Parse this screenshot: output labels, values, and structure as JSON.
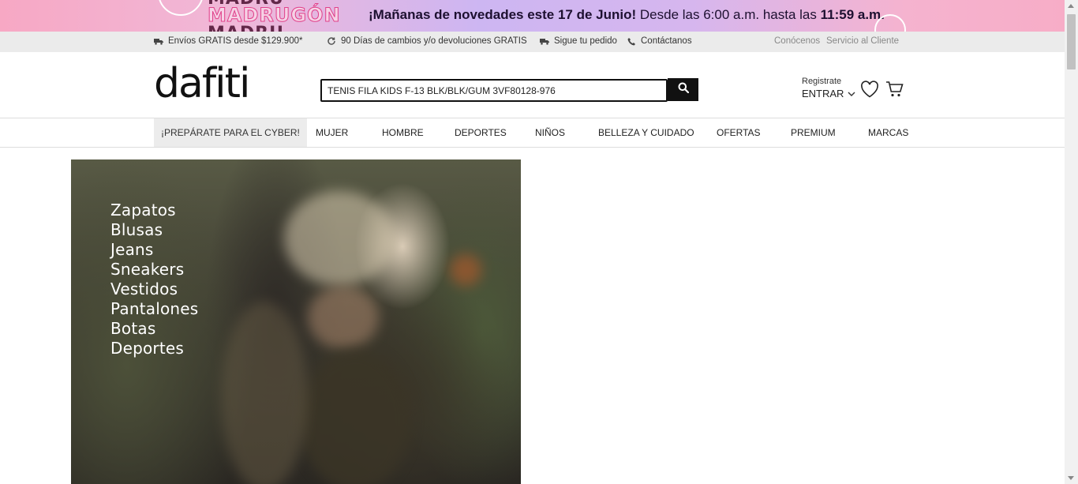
{
  "promo_banner": {
    "brand": "MADRUGÓN",
    "message_bold": "¡Mañanas de novedades este 17 de Junio!",
    "message_regular": "Desde las 6:00 a.m. hasta las",
    "message_time": "11:59 a.m."
  },
  "utility_bar": {
    "shipping": "Envíos GRATIS desde $129.900*",
    "returns": "90 Días de cambios y/o devoluciones GRATIS",
    "track": "Sigue tu pedido",
    "contact": "Contáctanos",
    "about": "Conócenos",
    "customer_service": "Servicio al Cliente"
  },
  "header": {
    "logo": "dafiti",
    "search_value": "TENIS FILA KIDS F-13 BLK/BLK/GUM 3VF80128-976",
    "register": "Registrate",
    "login": "ENTRAR"
  },
  "nav": {
    "items": [
      "¡PREPÁRATE PARA EL CYBER!",
      "MUJER",
      "HOMBRE",
      "DEPORTES",
      "NIÑOS",
      "BELLEZA Y CUIDADO",
      "OFERTAS",
      "PREMIUM",
      "MARCAS"
    ]
  },
  "hero": {
    "links": [
      "Zapatos",
      "Blusas",
      "Jeans",
      "Sneakers",
      "Vestidos",
      "Pantalones",
      "Botas",
      "Deportes"
    ]
  }
}
